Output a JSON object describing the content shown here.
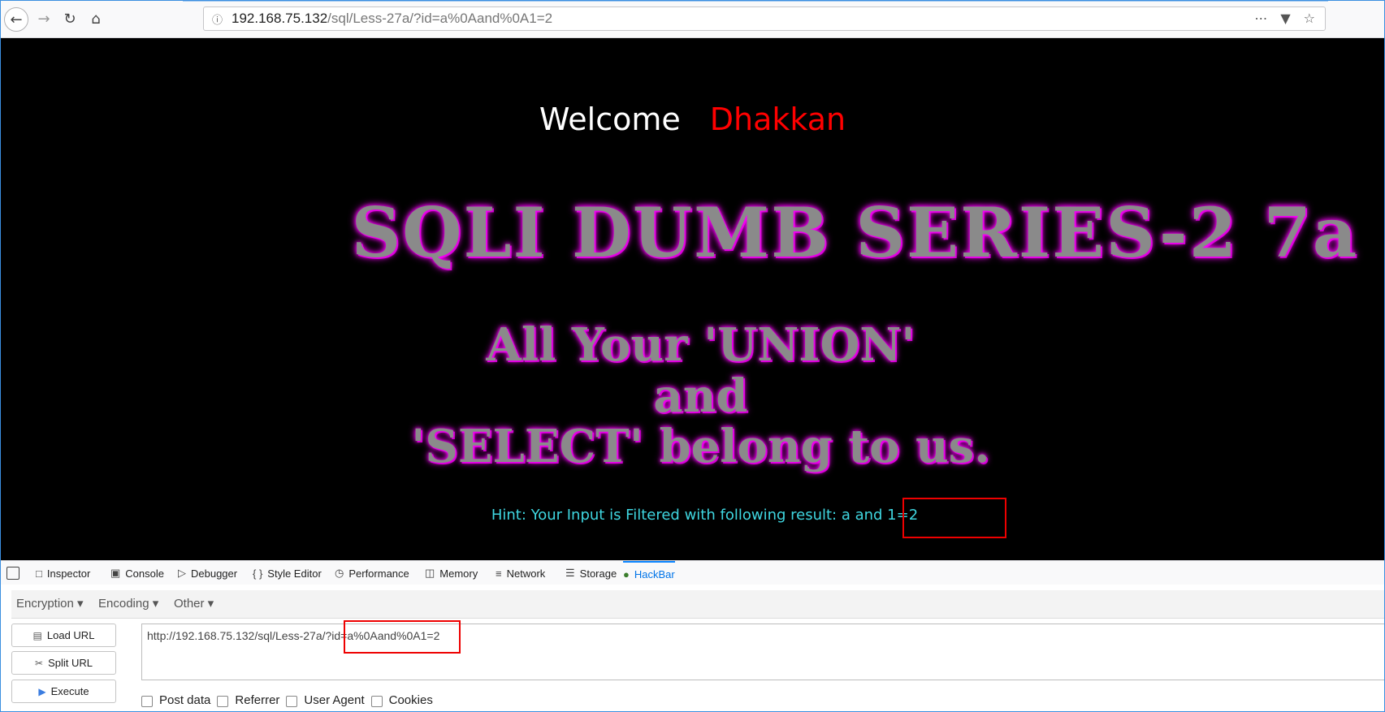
{
  "browser": {
    "url_host": "192.168.75.132",
    "url_path": "/sql/Less-27a/?id=a%0Aand%0A1=2",
    "icons": [
      "back-arrow-icon",
      "forward-arrow-icon",
      "reload-icon",
      "home-icon",
      "info-icon",
      "more-icon",
      "pocket-icon",
      "star-icon"
    ]
  },
  "page": {
    "welcome": "Welcome",
    "name": "Dhakkan",
    "title": "SQLI DUMB SERIES-2 7a",
    "tagline_1": "All Your 'UNION'",
    "tagline_2": "and",
    "tagline_3": "'SELECT' belong to us.",
    "hint": "Hint: Your Input is Filtered with following result: a and 1=2",
    "colors": {
      "background": "#000000",
      "welcome": "#ffffff",
      "name": "#ff0000",
      "hint": "#3fd6e0",
      "title_glow": "#ff00ff"
    }
  },
  "devtools": {
    "tabs": [
      {
        "label": "Inspector",
        "icon": "inspector-icon"
      },
      {
        "label": "Console",
        "icon": "console-icon"
      },
      {
        "label": "Debugger",
        "icon": "debugger-icon"
      },
      {
        "label": "Style Editor",
        "icon": "braces-icon"
      },
      {
        "label": "Performance",
        "icon": "performance-icon"
      },
      {
        "label": "Memory",
        "icon": "memory-icon"
      },
      {
        "label": "Network",
        "icon": "network-icon"
      },
      {
        "label": "Storage",
        "icon": "storage-icon"
      },
      {
        "label": "HackBar",
        "icon": "hackbar-icon",
        "active": true
      }
    ]
  },
  "hackbar": {
    "menu": [
      "Encryption",
      "Encoding",
      "Other"
    ],
    "buttons": {
      "load": "Load URL",
      "split": "Split URL",
      "execute": "Execute"
    },
    "url": "http://192.168.75.132/sql/Less-27a/?id=a%0Aand%0A1=2",
    "checkboxes": [
      "Post data",
      "Referrer",
      "User Agent",
      "Cookies"
    ]
  }
}
